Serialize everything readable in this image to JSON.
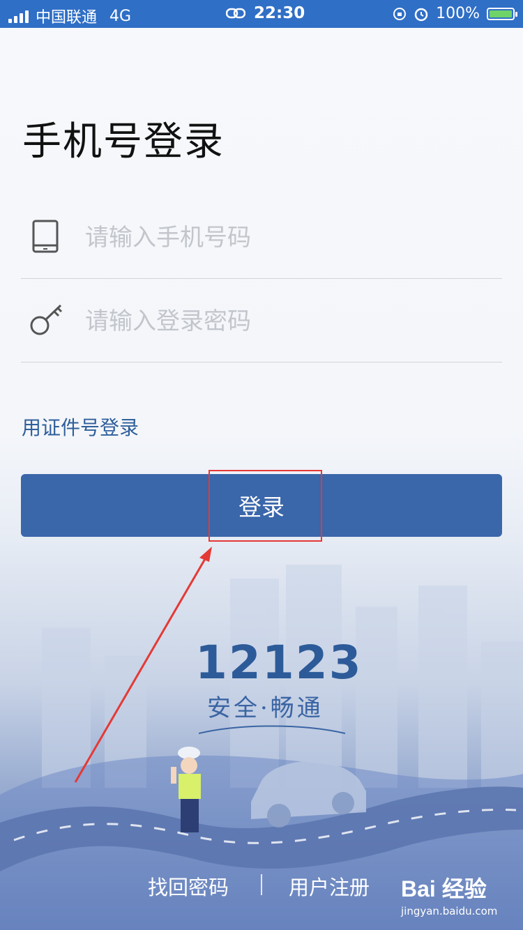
{
  "status_bar": {
    "carrier": "中国联通",
    "network": "4G",
    "time": "22:30",
    "battery": "100%"
  },
  "page": {
    "title": "手机号登录"
  },
  "phone_field": {
    "placeholder": "请输入手机号码",
    "value": ""
  },
  "password_field": {
    "placeholder": "请输入登录密码",
    "value": ""
  },
  "alt_login_link": "用证件号登录",
  "login_button": "登录",
  "brand": {
    "logo": "12123",
    "slogan": "安全·畅通"
  },
  "footer": {
    "recover_password": "找回密码",
    "register": "用户注册"
  },
  "watermark": {
    "brand": "Bai 经验",
    "url": "jingyan.baidu.com"
  },
  "colors": {
    "status_bar": "#2f6fc6",
    "button": "#3a66aa",
    "link": "#2f5f9a",
    "annotation": "#e53935"
  }
}
